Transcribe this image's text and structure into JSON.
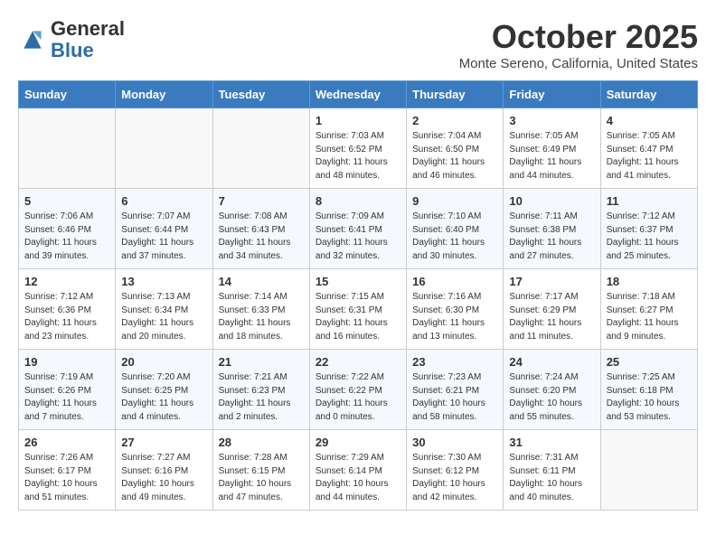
{
  "header": {
    "logo_line1": "General",
    "logo_line2": "Blue",
    "month": "October 2025",
    "location": "Monte Sereno, California, United States"
  },
  "days_of_week": [
    "Sunday",
    "Monday",
    "Tuesday",
    "Wednesday",
    "Thursday",
    "Friday",
    "Saturday"
  ],
  "weeks": [
    [
      {
        "day": "",
        "info": ""
      },
      {
        "day": "",
        "info": ""
      },
      {
        "day": "",
        "info": ""
      },
      {
        "day": "1",
        "info": "Sunrise: 7:03 AM\nSunset: 6:52 PM\nDaylight: 11 hours\nand 48 minutes."
      },
      {
        "day": "2",
        "info": "Sunrise: 7:04 AM\nSunset: 6:50 PM\nDaylight: 11 hours\nand 46 minutes."
      },
      {
        "day": "3",
        "info": "Sunrise: 7:05 AM\nSunset: 6:49 PM\nDaylight: 11 hours\nand 44 minutes."
      },
      {
        "day": "4",
        "info": "Sunrise: 7:05 AM\nSunset: 6:47 PM\nDaylight: 11 hours\nand 41 minutes."
      }
    ],
    [
      {
        "day": "5",
        "info": "Sunrise: 7:06 AM\nSunset: 6:46 PM\nDaylight: 11 hours\nand 39 minutes."
      },
      {
        "day": "6",
        "info": "Sunrise: 7:07 AM\nSunset: 6:44 PM\nDaylight: 11 hours\nand 37 minutes."
      },
      {
        "day": "7",
        "info": "Sunrise: 7:08 AM\nSunset: 6:43 PM\nDaylight: 11 hours\nand 34 minutes."
      },
      {
        "day": "8",
        "info": "Sunrise: 7:09 AM\nSunset: 6:41 PM\nDaylight: 11 hours\nand 32 minutes."
      },
      {
        "day": "9",
        "info": "Sunrise: 7:10 AM\nSunset: 6:40 PM\nDaylight: 11 hours\nand 30 minutes."
      },
      {
        "day": "10",
        "info": "Sunrise: 7:11 AM\nSunset: 6:38 PM\nDaylight: 11 hours\nand 27 minutes."
      },
      {
        "day": "11",
        "info": "Sunrise: 7:12 AM\nSunset: 6:37 PM\nDaylight: 11 hours\nand 25 minutes."
      }
    ],
    [
      {
        "day": "12",
        "info": "Sunrise: 7:12 AM\nSunset: 6:36 PM\nDaylight: 11 hours\nand 23 minutes."
      },
      {
        "day": "13",
        "info": "Sunrise: 7:13 AM\nSunset: 6:34 PM\nDaylight: 11 hours\nand 20 minutes."
      },
      {
        "day": "14",
        "info": "Sunrise: 7:14 AM\nSunset: 6:33 PM\nDaylight: 11 hours\nand 18 minutes."
      },
      {
        "day": "15",
        "info": "Sunrise: 7:15 AM\nSunset: 6:31 PM\nDaylight: 11 hours\nand 16 minutes."
      },
      {
        "day": "16",
        "info": "Sunrise: 7:16 AM\nSunset: 6:30 PM\nDaylight: 11 hours\nand 13 minutes."
      },
      {
        "day": "17",
        "info": "Sunrise: 7:17 AM\nSunset: 6:29 PM\nDaylight: 11 hours\nand 11 minutes."
      },
      {
        "day": "18",
        "info": "Sunrise: 7:18 AM\nSunset: 6:27 PM\nDaylight: 11 hours\nand 9 minutes."
      }
    ],
    [
      {
        "day": "19",
        "info": "Sunrise: 7:19 AM\nSunset: 6:26 PM\nDaylight: 11 hours\nand 7 minutes."
      },
      {
        "day": "20",
        "info": "Sunrise: 7:20 AM\nSunset: 6:25 PM\nDaylight: 11 hours\nand 4 minutes."
      },
      {
        "day": "21",
        "info": "Sunrise: 7:21 AM\nSunset: 6:23 PM\nDaylight: 11 hours\nand 2 minutes."
      },
      {
        "day": "22",
        "info": "Sunrise: 7:22 AM\nSunset: 6:22 PM\nDaylight: 11 hours\nand 0 minutes."
      },
      {
        "day": "23",
        "info": "Sunrise: 7:23 AM\nSunset: 6:21 PM\nDaylight: 10 hours\nand 58 minutes."
      },
      {
        "day": "24",
        "info": "Sunrise: 7:24 AM\nSunset: 6:20 PM\nDaylight: 10 hours\nand 55 minutes."
      },
      {
        "day": "25",
        "info": "Sunrise: 7:25 AM\nSunset: 6:18 PM\nDaylight: 10 hours\nand 53 minutes."
      }
    ],
    [
      {
        "day": "26",
        "info": "Sunrise: 7:26 AM\nSunset: 6:17 PM\nDaylight: 10 hours\nand 51 minutes."
      },
      {
        "day": "27",
        "info": "Sunrise: 7:27 AM\nSunset: 6:16 PM\nDaylight: 10 hours\nand 49 minutes."
      },
      {
        "day": "28",
        "info": "Sunrise: 7:28 AM\nSunset: 6:15 PM\nDaylight: 10 hours\nand 47 minutes."
      },
      {
        "day": "29",
        "info": "Sunrise: 7:29 AM\nSunset: 6:14 PM\nDaylight: 10 hours\nand 44 minutes."
      },
      {
        "day": "30",
        "info": "Sunrise: 7:30 AM\nSunset: 6:12 PM\nDaylight: 10 hours\nand 42 minutes."
      },
      {
        "day": "31",
        "info": "Sunrise: 7:31 AM\nSunset: 6:11 PM\nDaylight: 10 hours\nand 40 minutes."
      },
      {
        "day": "",
        "info": ""
      }
    ]
  ]
}
